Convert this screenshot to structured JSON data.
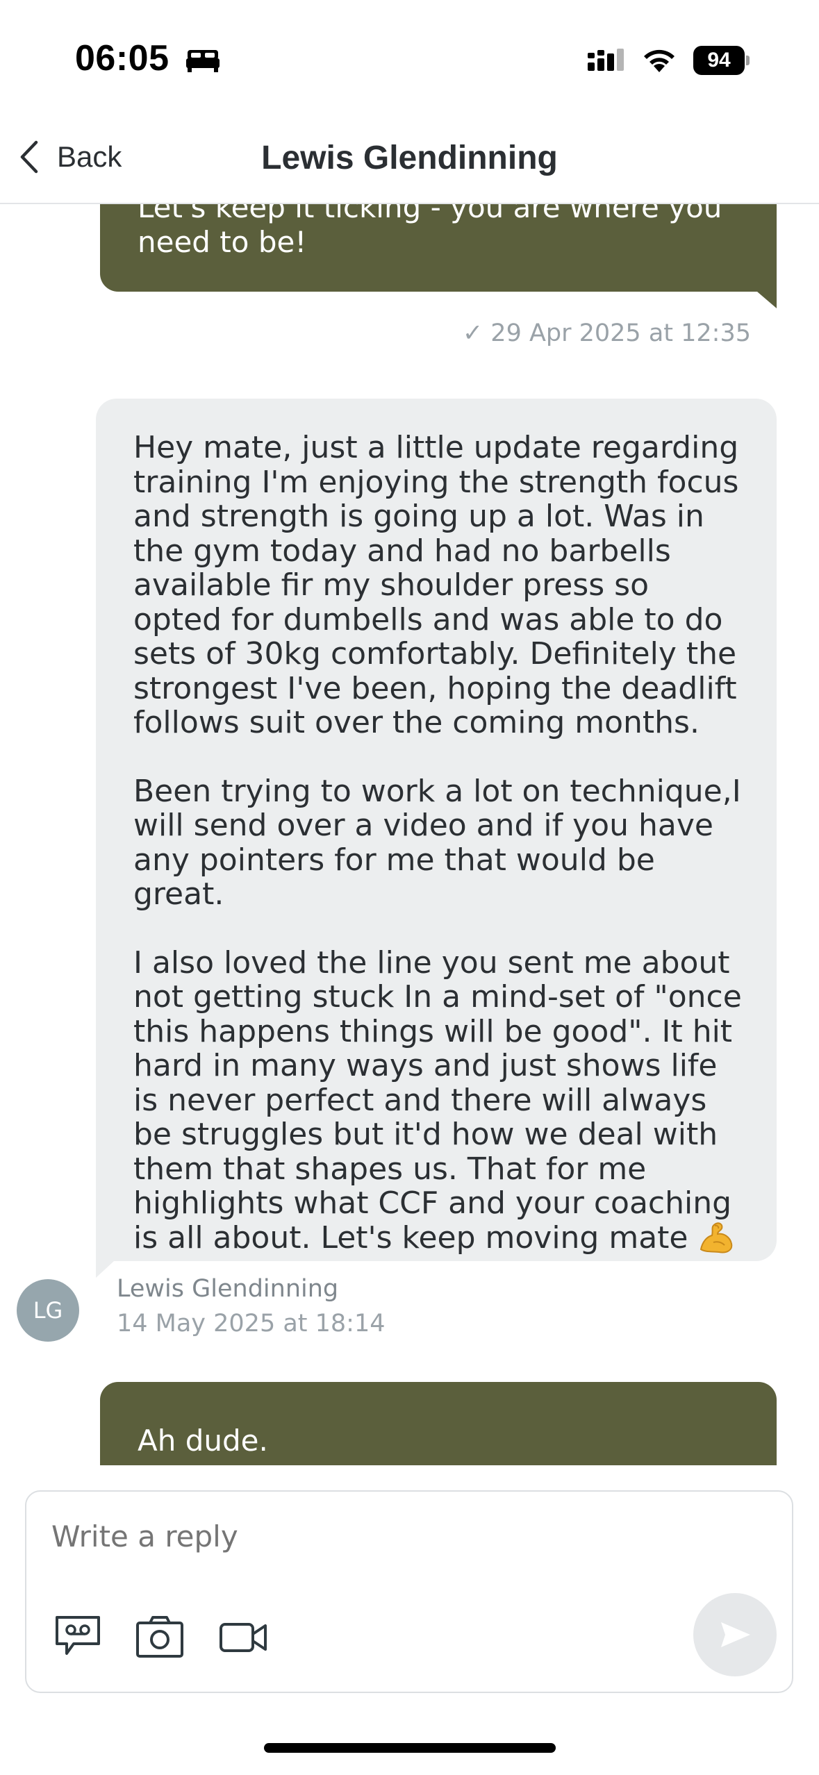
{
  "status_bar": {
    "time": "06:05",
    "battery": "94"
  },
  "nav": {
    "back_label": "Back",
    "title": "Lewis Glendinning"
  },
  "messages": [
    {
      "direction": "outgoing",
      "text": "Let's keep it ticking - you are where you\nneed to be!",
      "meta": "✓ 29 Apr 2025 at 12:35"
    },
    {
      "direction": "incoming",
      "paragraphs": [
        "Hey mate, just a little update regarding training I'm enjoying the strength focus and strength is going up a lot. Was in the gym today and had no barbells available fir my shoulder press so opted for dumbells and was able to do sets of 30kg comfortably. Definitely the strongest I've been, hoping the deadlift follows suit over the coming months.",
        "Been trying to work a lot on technique,I will send over a video and if you have any pointers for me that would be great.",
        "I also loved the line you sent me about not getting stuck In a mind-set of \"once this happens things will be good\". It hit hard in many ways and just shows life is never perfect and there will always be struggles but it'd how we deal with them that shapes us. That for me highlights what CCF and your coaching is all about. Let's keep moving mate"
      ],
      "emoji": "flexed-biceps",
      "author": "Lewis Glendinning",
      "avatar_initials": "LG",
      "time": "14 May 2025 at 18:14"
    },
    {
      "direction": "outgoing",
      "text": "Ah dude."
    }
  ],
  "composer": {
    "placeholder": "Write a reply"
  },
  "colors": {
    "outgoing_bubble": "#5b5f3c",
    "incoming_bubble": "#eceeef",
    "avatar": "#96a6ad"
  }
}
